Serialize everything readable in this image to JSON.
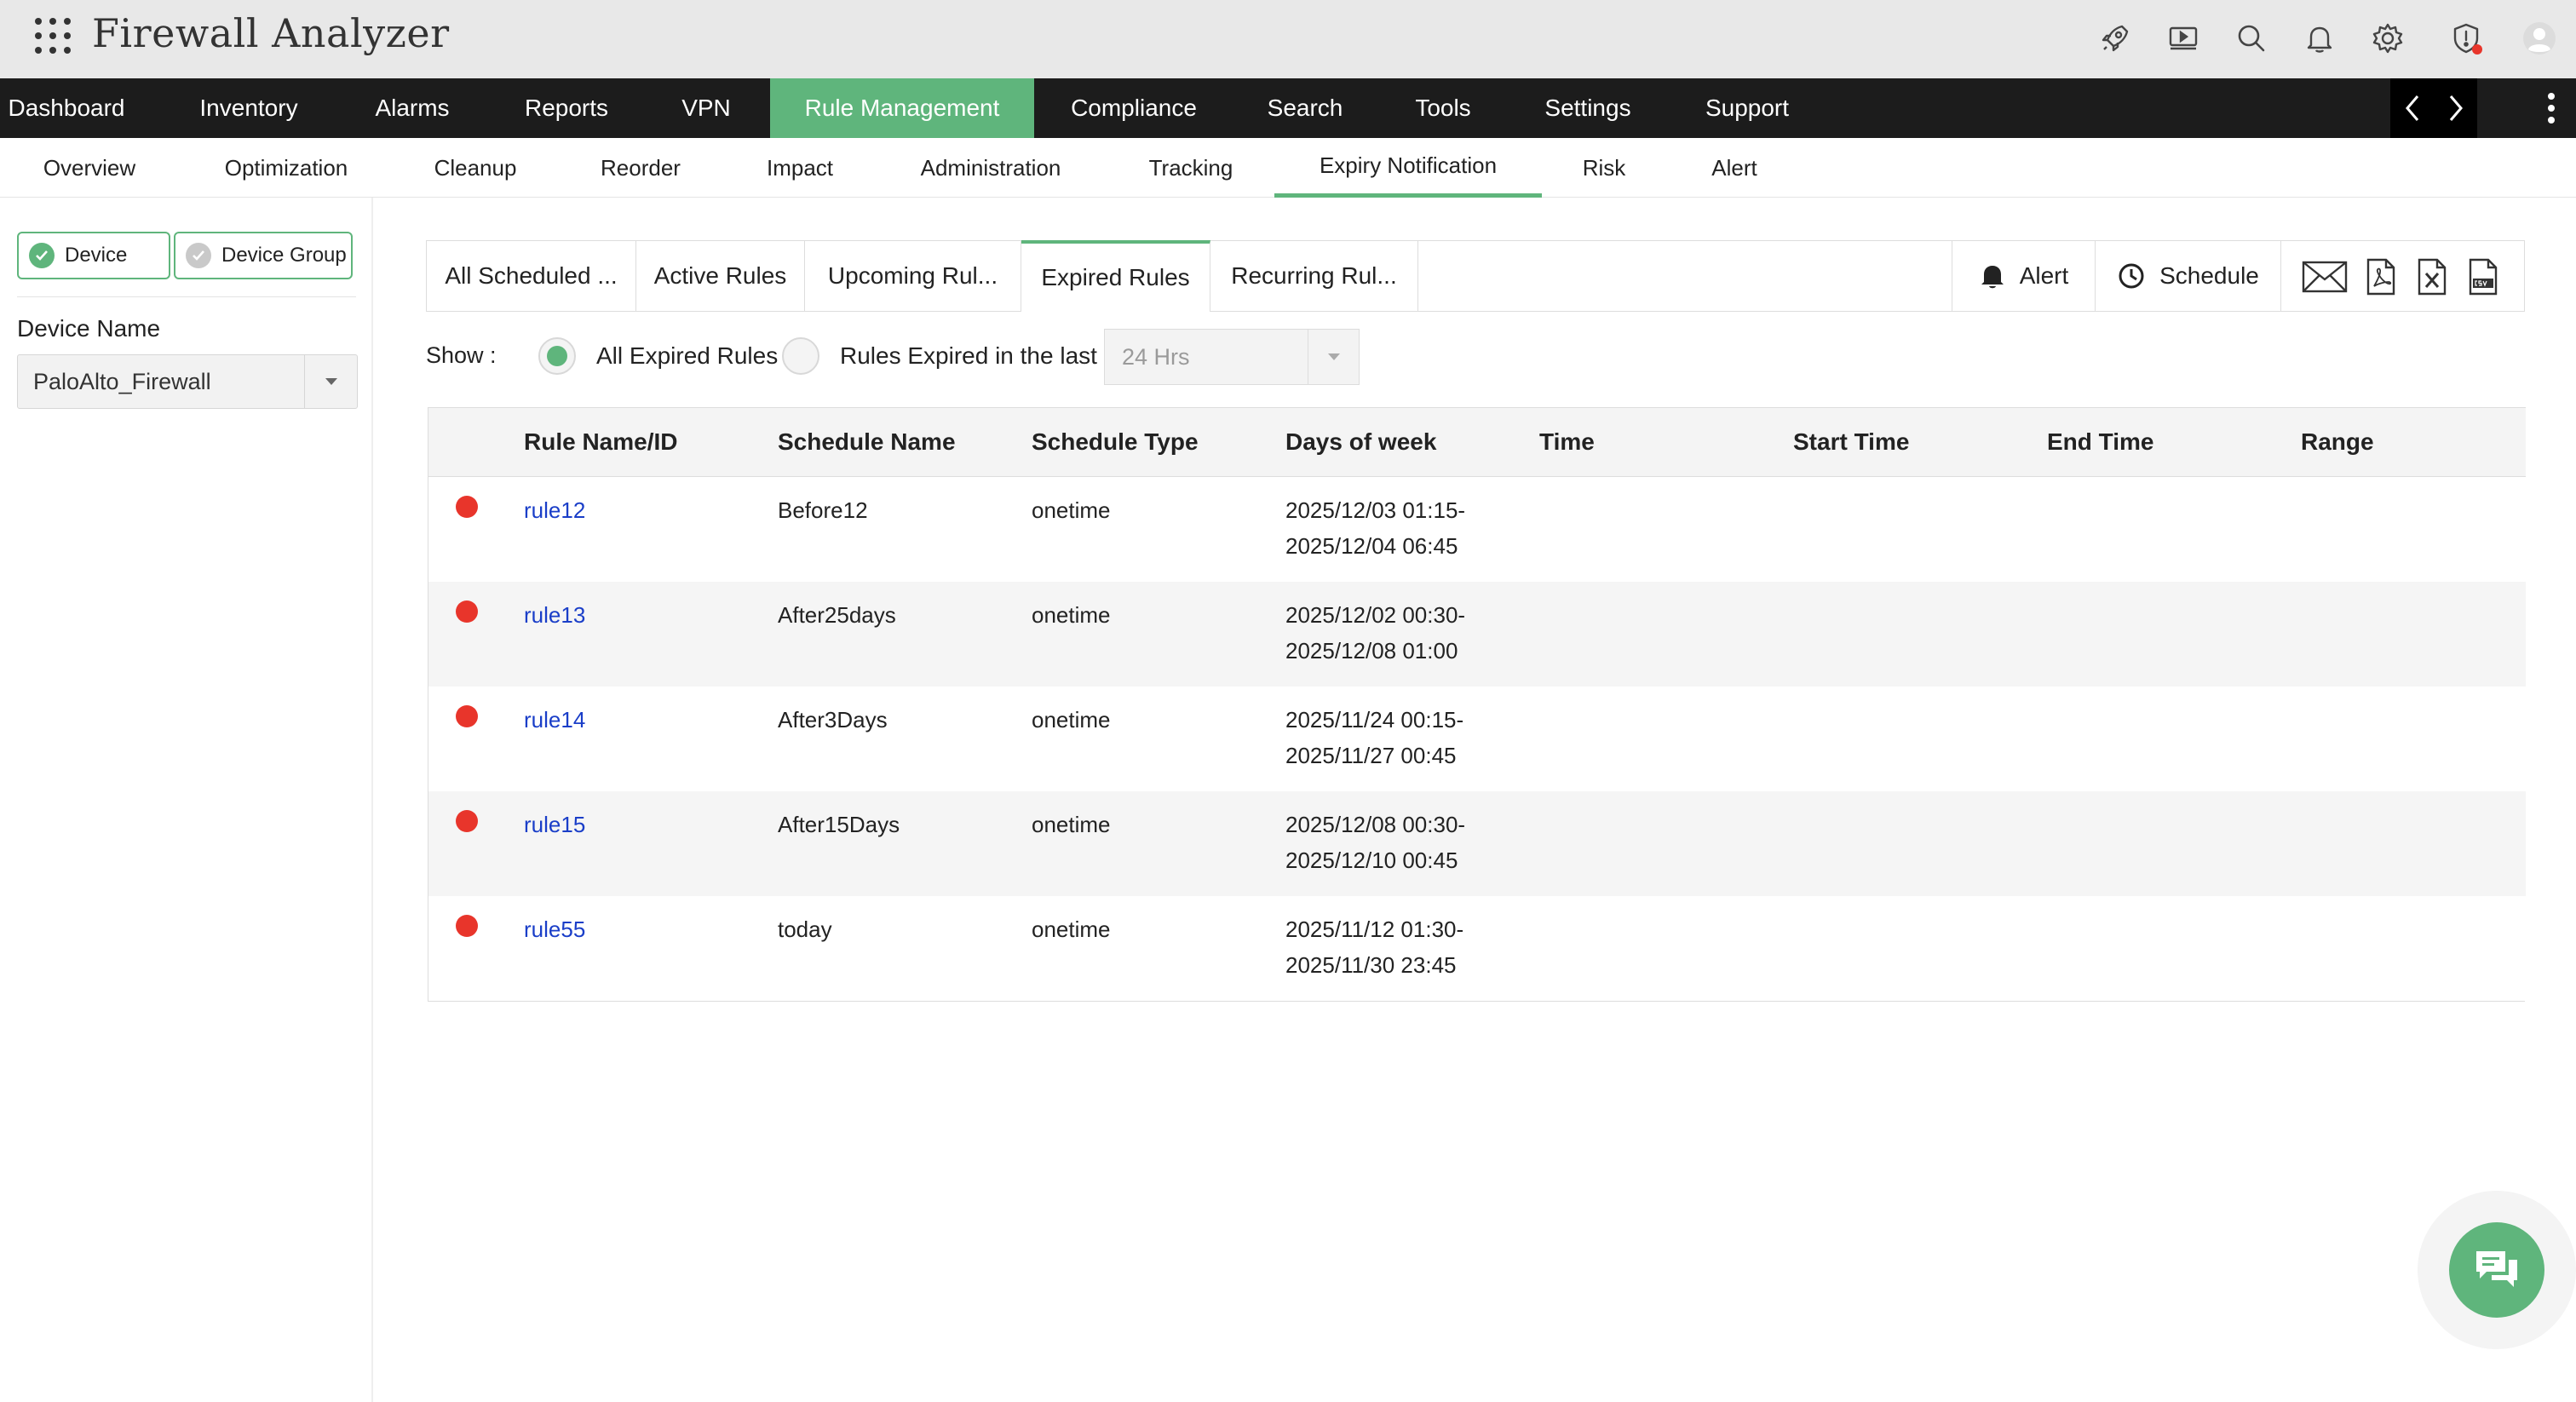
{
  "header": {
    "title": "Firewall Analyzer",
    "icons": [
      "apps-grid-icon",
      "rocket-icon",
      "video-icon",
      "search-icon",
      "bell-icon",
      "gear-icon",
      "shield-alert-icon",
      "user-avatar-icon"
    ]
  },
  "main_nav": {
    "items": [
      "Dashboard",
      "Inventory",
      "Alarms",
      "Reports",
      "VPN",
      "Rule Management",
      "Compliance",
      "Search",
      "Tools",
      "Settings",
      "Support"
    ],
    "active": "Rule Management"
  },
  "sub_nav": {
    "items": [
      "Overview",
      "Optimization",
      "Cleanup",
      "Reorder",
      "Impact",
      "Administration",
      "Tracking",
      "Expiry Notification",
      "Risk",
      "Alert"
    ],
    "active": "Expiry Notification"
  },
  "sidebar": {
    "device_label": "Device",
    "device_group_label": "Device Group",
    "device_name_label": "Device Name",
    "device_name_value": "PaloAlto_Firewall"
  },
  "tabs": {
    "items": [
      "All Scheduled ...",
      "Active Rules",
      "Upcoming Rul...",
      "Expired Rules",
      "Recurring Rul..."
    ],
    "active": "Expired Rules"
  },
  "toolbar": {
    "alert_label": "Alert",
    "schedule_label": "Schedule",
    "export_icons": [
      "mail-icon",
      "pdf-icon",
      "excel-icon",
      "csv-icon"
    ]
  },
  "filter": {
    "show_label": "Show :",
    "option_all": "All Expired Rules",
    "option_last": "Rules Expired in the last",
    "selected": "All Expired Rules",
    "period_value": "24 Hrs"
  },
  "table": {
    "columns": [
      "Rule Name/ID",
      "Schedule Name",
      "Schedule Type",
      "Days of week",
      "Time",
      "Start Time",
      "End Time",
      "Range"
    ],
    "rows": [
      {
        "rule": "rule12",
        "schedule_name": "Before12",
        "schedule_type": "onetime",
        "range_start": "2025/12/03 01:15-",
        "range_end": "2025/12/04 06:45"
      },
      {
        "rule": "rule13",
        "schedule_name": "After25days",
        "schedule_type": "onetime",
        "range_start": "2025/12/02 00:30-",
        "range_end": "2025/12/08 01:00"
      },
      {
        "rule": "rule14",
        "schedule_name": "After3Days",
        "schedule_type": "onetime",
        "range_start": "2025/11/24 00:15-",
        "range_end": "2025/11/27 00:45"
      },
      {
        "rule": "rule15",
        "schedule_name": "After15Days",
        "schedule_type": "onetime",
        "range_start": "2025/12/08 00:30-",
        "range_end": "2025/12/10 00:45"
      },
      {
        "rule": "rule55",
        "schedule_name": "today",
        "schedule_type": "onetime",
        "range_start": "2025/11/12 01:30-",
        "range_end": "2025/11/30 23:45"
      }
    ]
  },
  "colors": {
    "accent": "#5fb57c",
    "nav_bg": "#1c1c1c",
    "header_bg": "#e8e8e8",
    "link": "#1a3ec8",
    "status_expired": "#e8352b"
  }
}
